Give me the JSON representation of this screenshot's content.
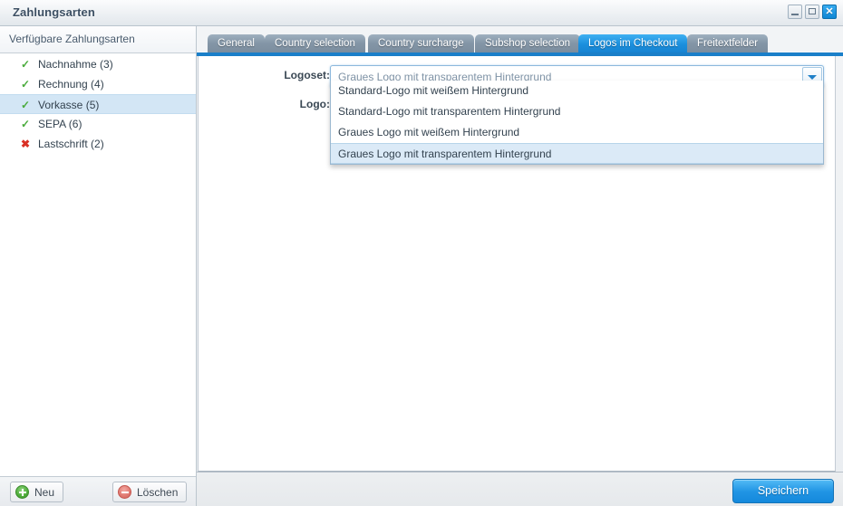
{
  "window": {
    "title": "Zahlungsarten",
    "controls": [
      {
        "name": "minimize",
        "icon": "minimize-icon"
      },
      {
        "name": "maximize",
        "icon": "maximize-icon"
      },
      {
        "name": "close",
        "icon": "close-icon",
        "glyph": "✕",
        "color": "#1788d9"
      }
    ]
  },
  "sidebar": {
    "header": "Verfügbare Zahlungsarten",
    "items": [
      {
        "label": "Nachnahme (3)",
        "status": "active",
        "icon": "check-icon",
        "glyph": "✓",
        "selected": false
      },
      {
        "label": "Rechnung (4)",
        "status": "active",
        "icon": "check-icon",
        "glyph": "✓",
        "selected": false
      },
      {
        "label": "Vorkasse (5)",
        "status": "active",
        "icon": "check-icon",
        "glyph": "✓",
        "selected": true
      },
      {
        "label": "SEPA (6)",
        "status": "active",
        "icon": "check-icon",
        "glyph": "✓",
        "selected": false
      },
      {
        "label": "Lastschrift (2)",
        "status": "inactive",
        "icon": "cross-icon",
        "glyph": "✖",
        "selected": false
      }
    ],
    "toolbar": {
      "new_label": "Neu",
      "delete_label": "Löschen"
    }
  },
  "tabs": [
    {
      "label": "General",
      "active": false
    },
    {
      "label": "Country selection",
      "active": false
    },
    {
      "label": "Country surcharge",
      "active": false
    },
    {
      "label": "Subshop selection",
      "active": false
    },
    {
      "label": "Logos im Checkout",
      "active": true
    },
    {
      "label": "Freitextfelder",
      "active": false
    }
  ],
  "form": {
    "logoset_label": "Logoset:",
    "logoset_value": "Graues Logo mit transparentem Hintergrund",
    "logo_label": "Logo:",
    "dropdown_open": true,
    "dropdown_options": [
      {
        "label": "Standard-Logo mit weißem Hintergrund",
        "highlighted": false
      },
      {
        "label": "Standard-Logo mit transparentem Hintergrund",
        "highlighted": false
      },
      {
        "label": "Graues Logo mit weißem Hintergrund",
        "highlighted": false
      },
      {
        "label": "Graues Logo mit transparentem Hintergrund",
        "highlighted": true
      }
    ]
  },
  "footer": {
    "save_label": "Speichern"
  },
  "colors": {
    "accent": "#1a7fc9",
    "tab_active": "#1b8fdd",
    "tab_inactive": "#8496a7",
    "selection": "#d3e6f5",
    "ok": "#4aab3c",
    "error": "#d93025",
    "title_text": "#3c4f63"
  }
}
